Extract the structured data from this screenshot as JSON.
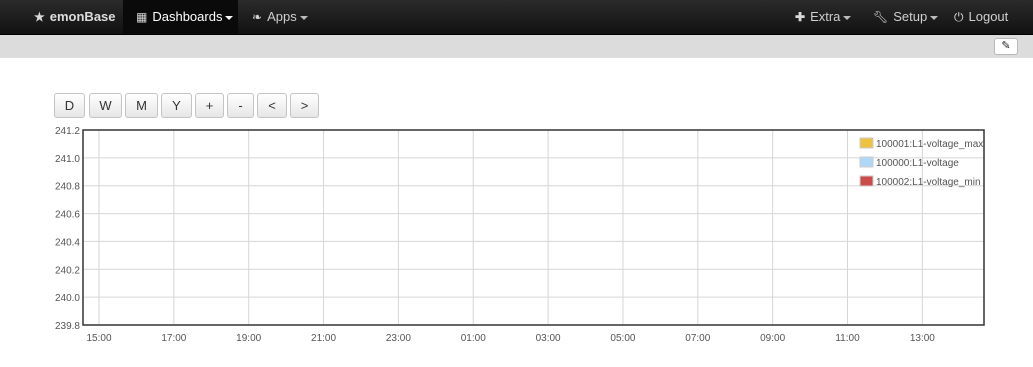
{
  "navbar": {
    "brand": {
      "icon": "star-icon",
      "label": "emonBase"
    },
    "dashboards": {
      "icon": "grid-icon",
      "label": "Dashboards"
    },
    "apps": {
      "icon": "leaf-icon",
      "label": "Apps"
    },
    "extra": {
      "icon": "plus-icon",
      "label": "Extra"
    },
    "setup": {
      "icon": "wrench-icon",
      "label": "Setup"
    },
    "logout": {
      "icon": "power-icon",
      "label": "Logout"
    }
  },
  "toolbar": {
    "edit_icon": "edit-icon"
  },
  "range_buttons": [
    {
      "id": "day",
      "label": "D"
    },
    {
      "id": "week",
      "label": "W"
    },
    {
      "id": "month",
      "label": "M"
    },
    {
      "id": "year",
      "label": "Y"
    },
    {
      "id": "zoom-in",
      "label": "+"
    },
    {
      "id": "zoom-out",
      "label": "-"
    },
    {
      "id": "pan-left",
      "label": "<"
    },
    {
      "id": "pan-right",
      "label": ">"
    }
  ],
  "chart_data": {
    "type": "line",
    "title": "",
    "xlabel": "",
    "ylabel": "",
    "x_ticks": [
      "15:00",
      "17:00",
      "19:00",
      "21:00",
      "23:00",
      "01:00",
      "03:00",
      "05:00",
      "07:00",
      "09:00",
      "11:00",
      "13:00"
    ],
    "y_ticks": [
      "241.2",
      "241.0",
      "240.8",
      "240.6",
      "240.4",
      "240.2",
      "240.0",
      "239.8"
    ],
    "ylim": [
      239.8,
      241.2
    ],
    "grid": true,
    "legend_position": "top-right",
    "series": [
      {
        "name": "100001:L1-voltage_max",
        "color": "#edc240",
        "values": []
      },
      {
        "name": "100000:L1-voltage",
        "color": "#afd8f8",
        "values": []
      },
      {
        "name": "100002:L1-voltage_min",
        "color": "#cb4b4b",
        "values": []
      }
    ]
  }
}
